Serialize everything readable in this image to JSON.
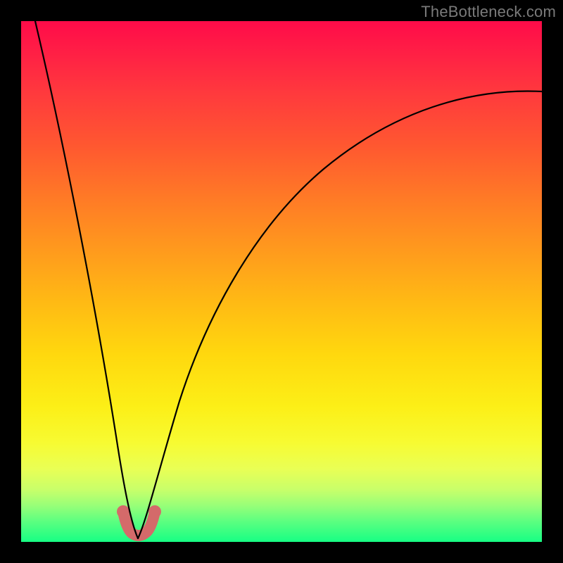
{
  "watermark": "TheBottleneck.com",
  "colors": {
    "frame": "#000000",
    "curve": "#000000",
    "dip_highlight": "#d46a6a",
    "gradient_stops": [
      "#ff0b49",
      "#ff1f45",
      "#ff3a3d",
      "#ff5830",
      "#ff7a26",
      "#ff9a1d",
      "#ffba14",
      "#ffd80e",
      "#fcef17",
      "#f7fb32",
      "#e9ff55",
      "#c8ff6a",
      "#98ff78",
      "#5dff80",
      "#17ff84"
    ]
  },
  "chart_data": {
    "type": "line",
    "title": "",
    "xlabel": "",
    "ylabel": "",
    "xlim": [
      0,
      100
    ],
    "ylim": [
      0,
      100
    ],
    "annotations": [
      "TheBottleneck.com"
    ],
    "dip_x_range": [
      19,
      25
    ],
    "series": [
      {
        "name": "left-branch",
        "x": [
          0,
          2,
          4,
          6,
          8,
          10,
          12,
          14,
          16,
          18,
          19,
          20,
          21,
          22
        ],
        "values": [
          100,
          91,
          82,
          73,
          64,
          55,
          46,
          37,
          27,
          14,
          7,
          3,
          1,
          0
        ]
      },
      {
        "name": "right-branch",
        "x": [
          22,
          23,
          24,
          25,
          26,
          28,
          30,
          33,
          36,
          40,
          45,
          50,
          55,
          60,
          66,
          72,
          78,
          85,
          92,
          100
        ],
        "values": [
          0,
          1,
          3,
          7,
          12,
          20,
          27,
          35,
          42,
          50,
          57,
          62,
          66,
          70,
          74,
          77,
          79,
          82,
          84,
          86
        ]
      }
    ]
  }
}
